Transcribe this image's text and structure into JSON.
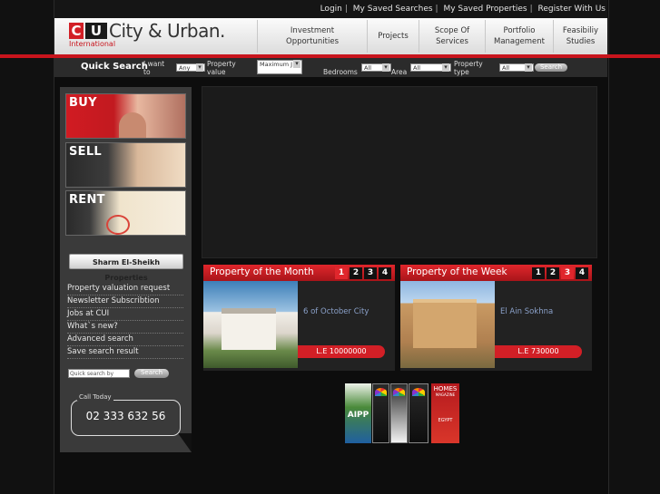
{
  "top_links": [
    "Login",
    "My Saved Searches",
    "My Saved Properties",
    "Register With Us"
  ],
  "logo": {
    "c": "C",
    "u": "U",
    "name": "City & Urban.",
    "sub": "International"
  },
  "nav": [
    "Investment Opportunities",
    "Projects",
    "Scope Of Services",
    "Portfolio Management",
    "Feasibiliy Studies"
  ],
  "quick_search": {
    "title": "Quick Search",
    "want_label": "I want to",
    "want_value": "Any",
    "value_label": "Property value",
    "value_value": "Maximum J",
    "bedrooms_label": "Bedrooms",
    "bedrooms_value": "All",
    "area_label": "Area",
    "area_value": "All",
    "type_label": "Property type",
    "type_value": "All",
    "search_label": "Search"
  },
  "sidebar": {
    "tiles": [
      "BUY",
      "SELL",
      "RENT"
    ],
    "sharm": "Sharm El-Sheikh Properties",
    "links": [
      "Property valuation request",
      "Newsletter Subscribtion",
      "Jobs at CUI",
      "What`s new?",
      "Advanced search",
      "Save search result"
    ],
    "quick_search_placeholder": "Quick search by serial",
    "quick_search_button": "Search",
    "call_label": "Call Today",
    "phone": "02 333 632 56"
  },
  "property_month": {
    "title": "Property of the Month",
    "pages": [
      "1",
      "2",
      "3",
      "4"
    ],
    "location": "6 of October City",
    "price": "L.E 10000000"
  },
  "property_week": {
    "title": "Property of the Week",
    "pages": [
      "1",
      "2",
      "3",
      "4"
    ],
    "location": "El Ain Sokhna",
    "price": "L.E 730000"
  },
  "badges": {
    "aipp": "AIPP",
    "homes1": "HOMES",
    "homes2": "MAGAZINE",
    "egypt": "EGYPT"
  },
  "colors": {
    "brand_red": "#d21f26",
    "dark": "#0d0d0d"
  }
}
